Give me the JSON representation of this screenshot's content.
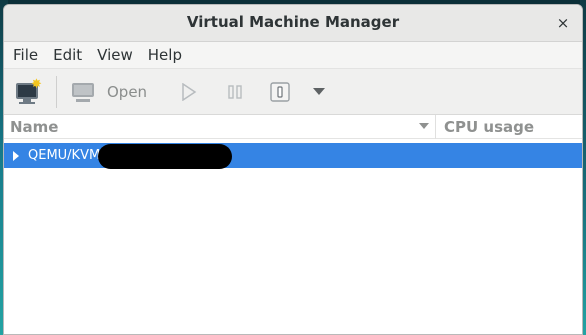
{
  "window": {
    "title": "Virtual Machine Manager",
    "close_symbol": "×"
  },
  "menu": {
    "items": [
      "File",
      "Edit",
      "View",
      "Help"
    ]
  },
  "toolbar": {
    "new_vm_icon": "new-vm-icon",
    "open_icon": "monitor-icon",
    "open_label": "Open",
    "run_icon": "play-icon",
    "pause_icon": "pause-icon",
    "shutdown_icon": "power-icon",
    "more_icon": "chevron-down-icon"
  },
  "list": {
    "columns": [
      "Name",
      "CPU usage"
    ],
    "rows": [
      {
        "label": "QEMU/KVM",
        "selected": true,
        "expanded": false
      }
    ]
  },
  "colors": {
    "selection": "#3584e4",
    "titlebar": "#e8e8e7",
    "star": "#f3c51f"
  }
}
